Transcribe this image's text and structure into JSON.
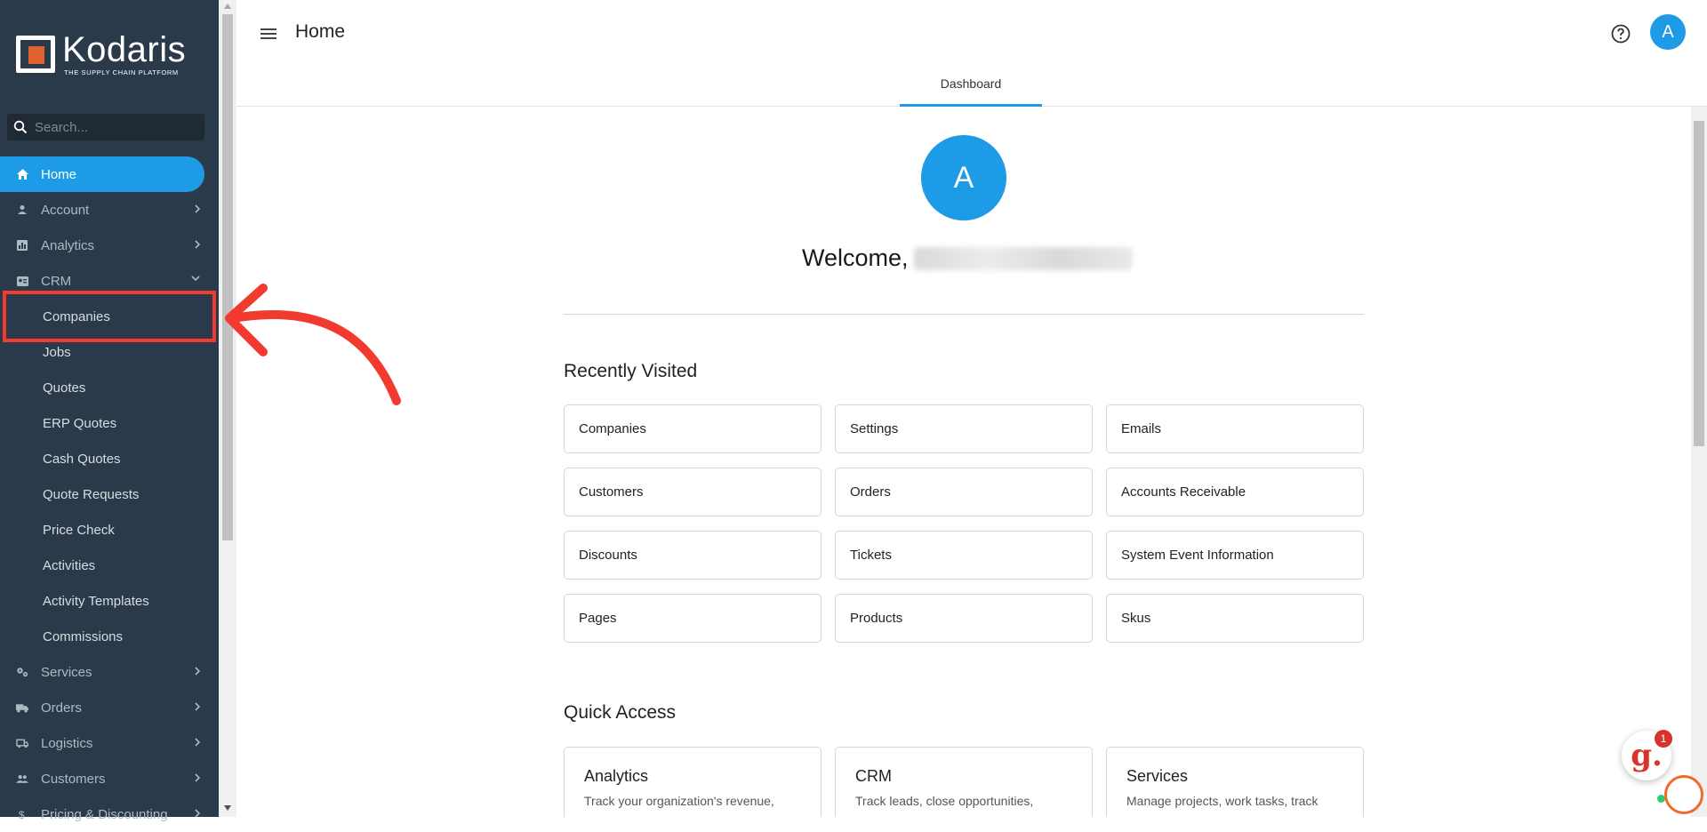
{
  "brand": {
    "name": "Kodaris",
    "tagline": "THE SUPPLY CHAIN PLATFORM",
    "accent": "#1e9be6",
    "logo_orange": "#e0622e"
  },
  "search": {
    "placeholder": "Search..."
  },
  "nav": {
    "home": "Home",
    "account": "Account",
    "analytics": "Analytics",
    "crm": "CRM",
    "crm_children": [
      "Companies",
      "Jobs",
      "Quotes",
      "ERP Quotes",
      "Cash Quotes",
      "Quote Requests",
      "Price Check",
      "Activities",
      "Activity Templates",
      "Commissions"
    ],
    "services": "Services",
    "orders": "Orders",
    "logistics": "Logistics",
    "customers": "Customers",
    "pricing": "Pricing & Discounting"
  },
  "header": {
    "title": "Home",
    "avatar_letter": "A",
    "tab": "Dashboard"
  },
  "welcome": {
    "avatar_letter": "A",
    "text": "Welcome,"
  },
  "recent": {
    "title": "Recently Visited",
    "items": [
      "Companies",
      "Settings",
      "Emails",
      "Customers",
      "Orders",
      "Accounts Receivable",
      "Discounts",
      "Tickets",
      "System Event Information",
      "Pages",
      "Products",
      "Skus"
    ]
  },
  "quick_access": {
    "title": "Quick Access",
    "cards": [
      {
        "title": "Analytics",
        "desc": "Track your organization's revenue,"
      },
      {
        "title": "CRM",
        "desc": "Track leads, close opportunities,"
      },
      {
        "title": "Services",
        "desc": "Manage projects, work tasks, track"
      }
    ]
  },
  "widgets": {
    "chat_letter": "g.",
    "badge": "1"
  },
  "annotation_color": "#f23b2e"
}
